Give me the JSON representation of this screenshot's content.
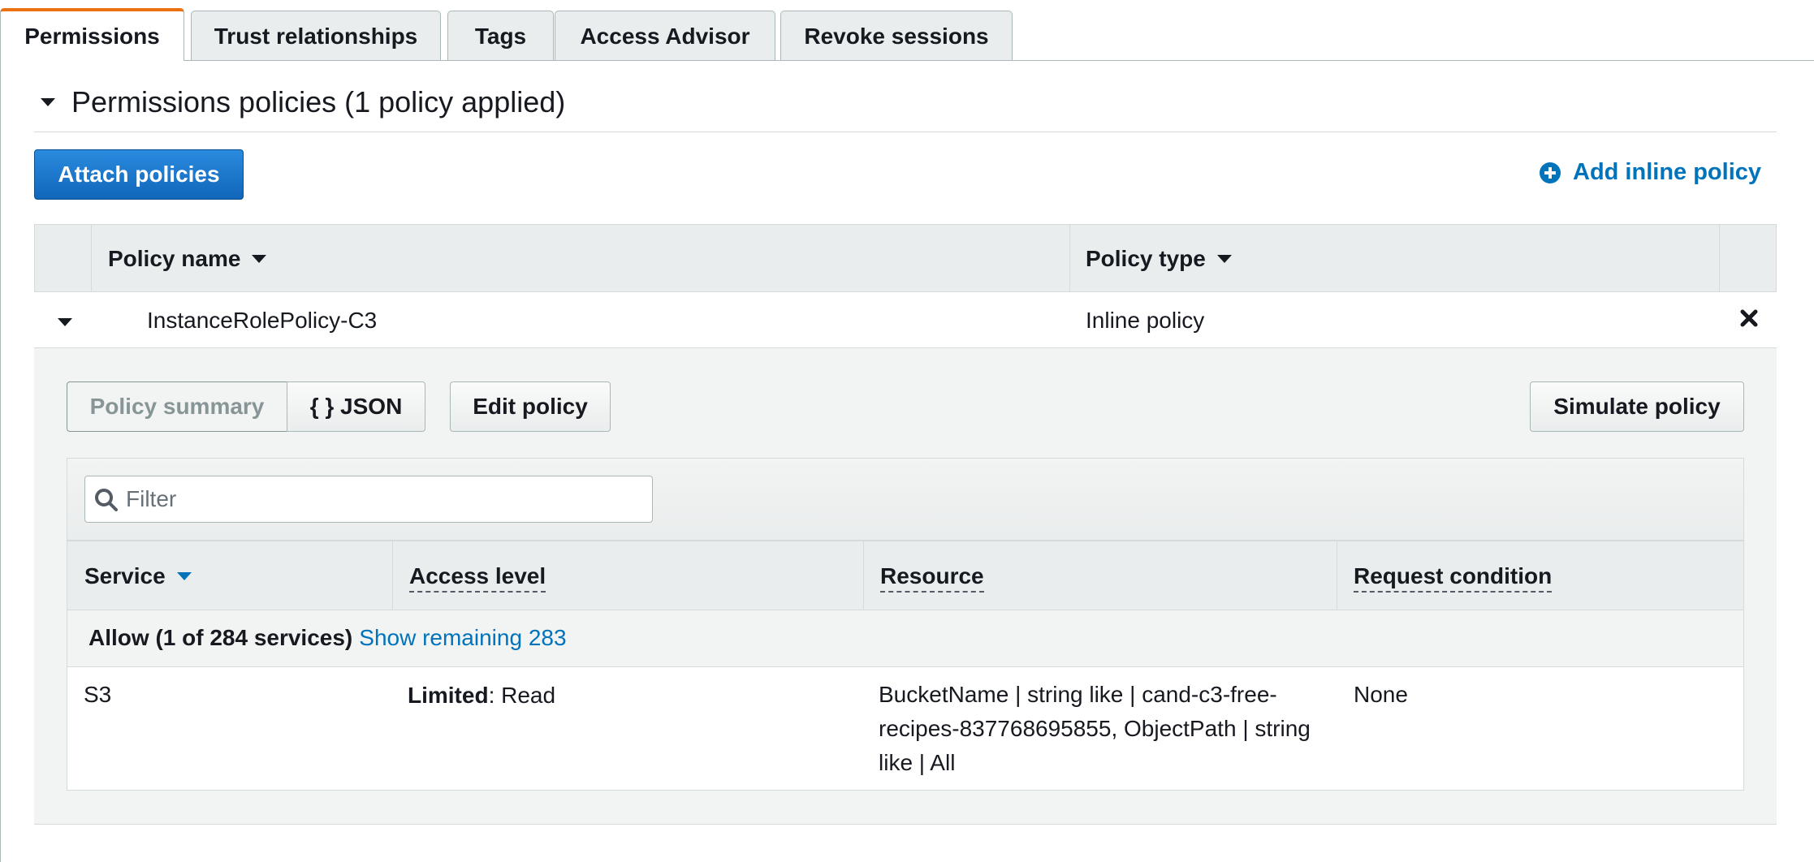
{
  "tabs": [
    {
      "label": "Permissions",
      "active": true
    },
    {
      "label": "Trust relationships",
      "active": false
    },
    {
      "label": "Tags",
      "active": false
    },
    {
      "label": "Access Advisor",
      "active": false
    },
    {
      "label": "Revoke sessions",
      "active": false
    }
  ],
  "section": {
    "title": "Permissions policies (1 policy applied)",
    "attach_button": "Attach policies",
    "add_inline": "Add inline policy"
  },
  "policy_table": {
    "columns": [
      "Policy name",
      "Policy type"
    ],
    "row": {
      "name": "InstanceRolePolicy-C3",
      "type": "Inline policy"
    }
  },
  "details": {
    "view_toggle": [
      "Policy summary",
      "{ } JSON"
    ],
    "edit_button": "Edit policy",
    "simulate_button": "Simulate policy",
    "filter_placeholder": "Filter",
    "columns": [
      "Service",
      "Access level",
      "Resource",
      "Request condition"
    ],
    "allow_label": "Allow (1 of 284 services)",
    "show_remaining": "Show remaining 283",
    "rows": [
      {
        "service": "S3",
        "access_prefix": "Limited",
        "access_suffix": ": Read",
        "resource_lines": [
          "BucketName | string like | cand-c3-free-",
          "recipes-837768695855, ObjectPath | string",
          "like | All"
        ],
        "condition": "None"
      }
    ]
  },
  "colors": {
    "accent_tab": "#ec7211",
    "primary_button": "#1166bb",
    "link": "#0073bb"
  }
}
